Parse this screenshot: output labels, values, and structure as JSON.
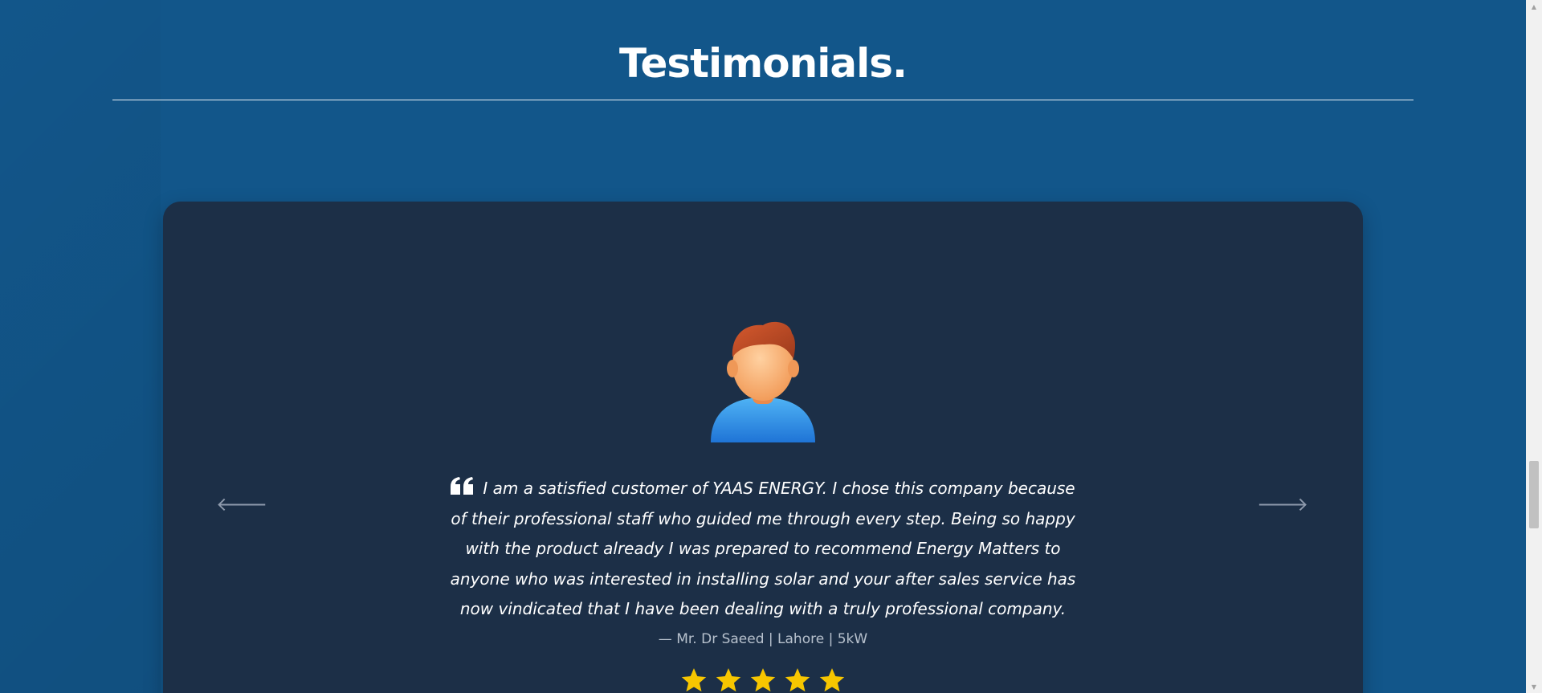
{
  "section": {
    "title": "Testimonials."
  },
  "testimonial": {
    "avatar_icon": "user-avatar-icon",
    "quote_icon": "quote-open-icon",
    "text": "I am a satisfied customer of YAAS ENERGY. I chose this company because of their professional staff who guided me through every step. Being so happy with the product already I was prepared to recommend Energy Matters to anyone who was interested in installing solar and your after sales service has now vindicated that I have been dealing with a truly professional company.",
    "author": "—  Mr. Dr Saeed | Lahore | 5kW",
    "rating": 5,
    "rating_max": 5
  },
  "carousel": {
    "prev_icon": "arrow-left-icon",
    "next_icon": "arrow-right-icon",
    "prev_glyph": "🡐",
    "next_glyph": "🡒"
  },
  "colors": {
    "page_background": "#12568a",
    "card_background": "#1c2f47",
    "star": "#f7c600",
    "text": "#ffffff",
    "author_text": "#b7c1cd"
  }
}
